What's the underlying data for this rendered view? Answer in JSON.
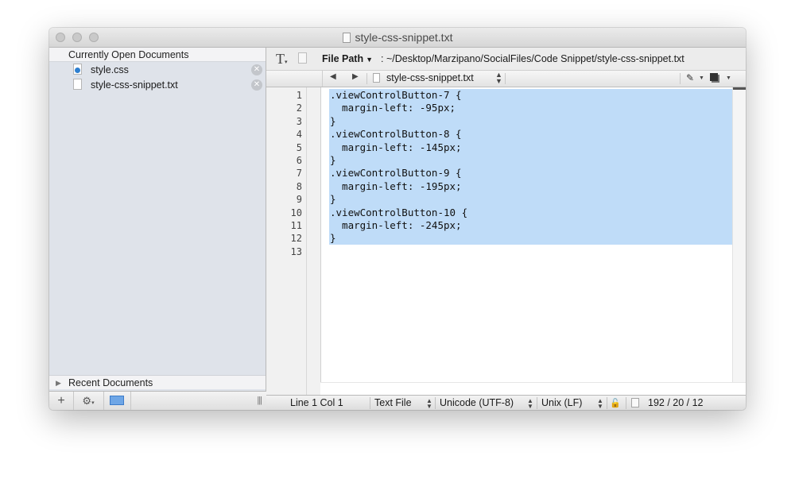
{
  "window": {
    "title": "style-css-snippet.txt"
  },
  "sidebar": {
    "open_header": "Currently Open Documents",
    "open_documents": [
      {
        "name": "style.css",
        "icon": "css-file-icon"
      },
      {
        "name": "style-css-snippet.txt",
        "icon": "text-file-icon"
      }
    ],
    "recent_header": "Recent Documents",
    "bottom": {
      "add_label": "+",
      "gear_label": "⚙"
    }
  },
  "pathbar": {
    "label": "File Path",
    "value": ": ~/Desktop/Marzipano/SocialFiles/Code Snippet/style-css-snippet.txt"
  },
  "navbar": {
    "current_file": "style-css-snippet.txt"
  },
  "editor": {
    "line_numbers": [
      "1",
      "2",
      "3",
      "4",
      "5",
      "6",
      "7",
      "8",
      "9",
      "10",
      "11",
      "12",
      "13"
    ],
    "lines": [
      ".viewControlButton-7 {",
      "  margin-left: -95px;",
      "}",
      ".viewControlButton-8 {",
      "  margin-left: -145px;",
      "}",
      ".viewControlButton-9 {",
      "  margin-left: -195px;",
      "}",
      ".viewControlButton-10 {",
      "  margin-left: -245px;",
      "}",
      ""
    ],
    "selection_color": "#bfdcf8"
  },
  "status": {
    "position": "Line 1 Col 1",
    "file_type": "Text File",
    "encoding": "Unicode (UTF-8)",
    "line_endings": "Unix (LF)",
    "counts": "192 / 20 / 12"
  }
}
